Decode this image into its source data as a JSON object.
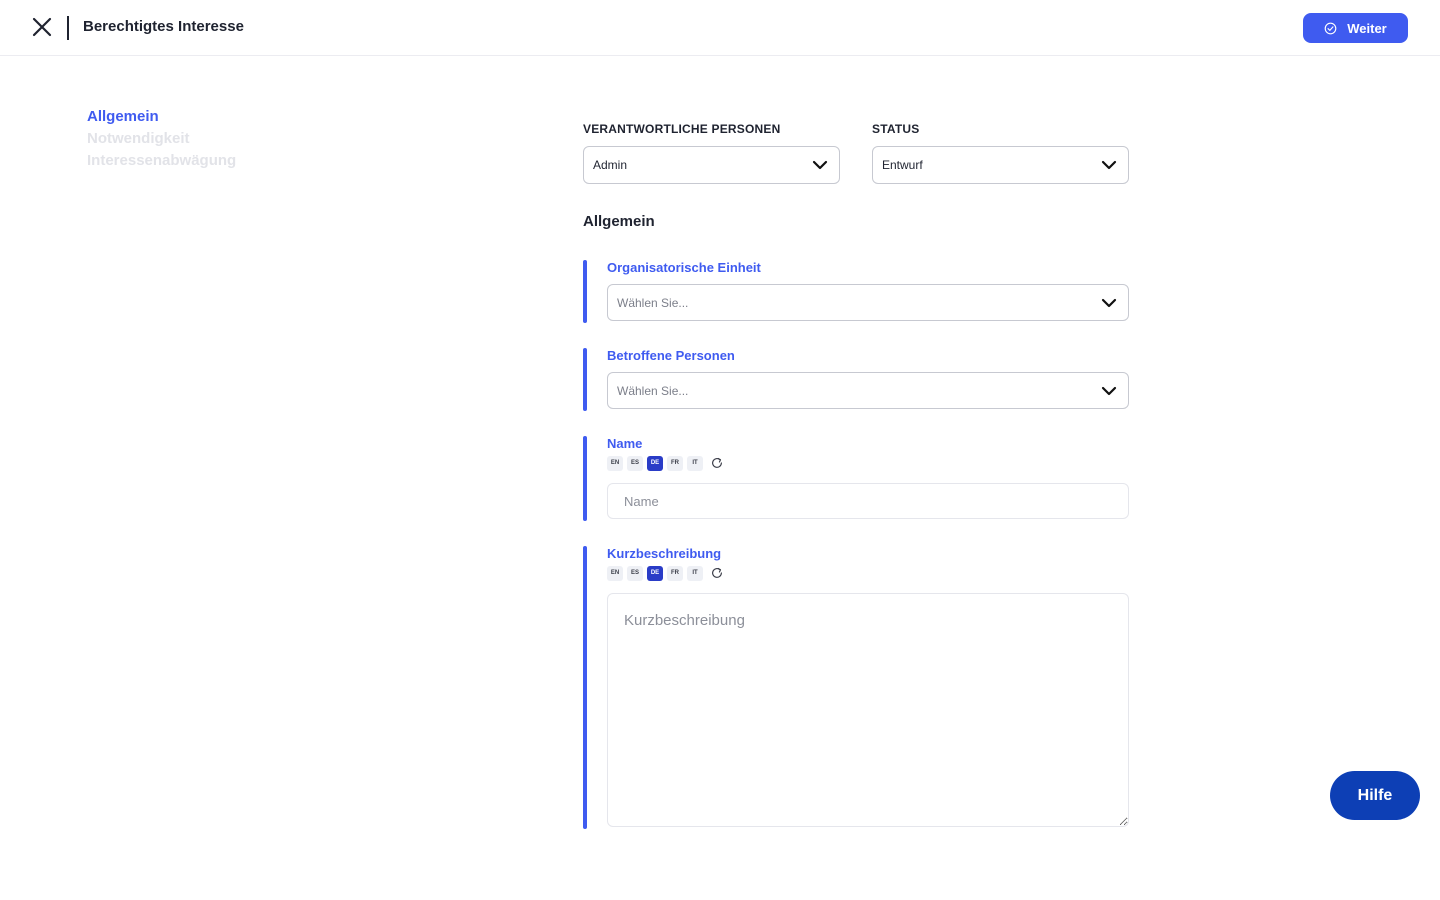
{
  "header": {
    "title": "Berechtigtes Interesse",
    "continue_label": "Weiter"
  },
  "sidenav": {
    "items": [
      {
        "label": "Allgemein",
        "active": true
      },
      {
        "label": "Notwendigkeit",
        "active": false
      },
      {
        "label": "Interessenabwägung",
        "active": false
      }
    ]
  },
  "top_fields": {
    "responsible": {
      "label": "VERANTWORTLICHE PERSONEN",
      "value": "Admin"
    },
    "status": {
      "label": "STATUS",
      "value": "Entwurf"
    }
  },
  "section": {
    "title": "Allgemein"
  },
  "fields": {
    "org_unit": {
      "label": "Organisatorische Einheit",
      "placeholder": "Wählen Sie..."
    },
    "affected": {
      "label": "Betroffene Personen",
      "placeholder": "Wählen Sie..."
    },
    "name": {
      "label": "Name",
      "placeholder": "Name",
      "value": ""
    },
    "summary": {
      "label": "Kurzbeschreibung",
      "placeholder": "Kurzbeschreibung",
      "value": ""
    }
  },
  "languages": [
    "EN",
    "ES",
    "DE",
    "FR",
    "IT"
  ],
  "active_language": "DE",
  "help_label": "Hilfe",
  "colors": {
    "accent": "#3f5bf0",
    "help": "#0d3fb5",
    "active_lang": "#2a3cc7"
  }
}
